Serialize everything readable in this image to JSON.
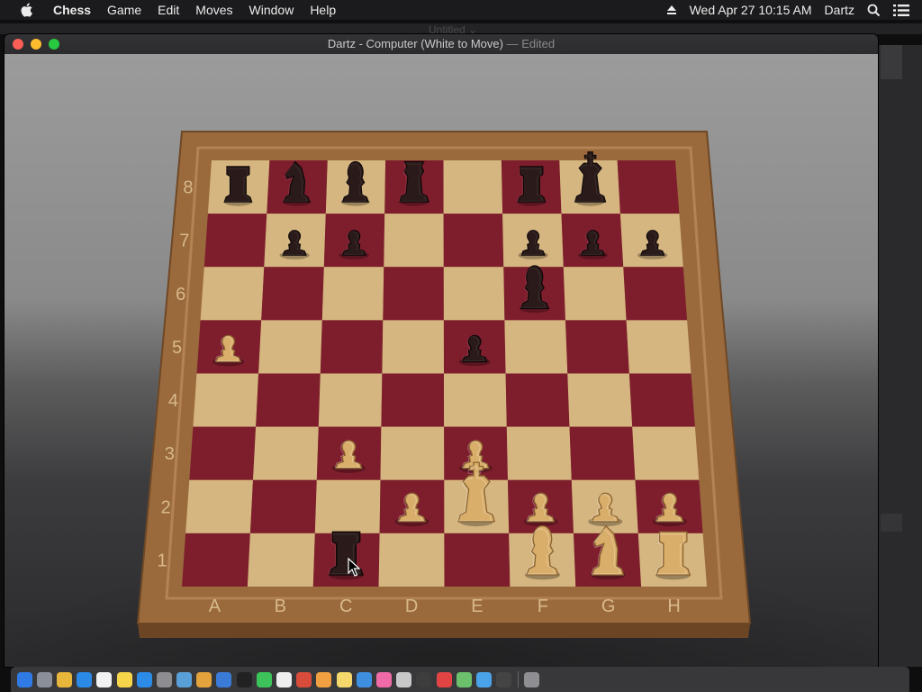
{
  "menubar": {
    "items": [
      {
        "label": "Chess",
        "name": "menu-chess"
      },
      {
        "label": "Game",
        "name": "menu-game"
      },
      {
        "label": "Edit",
        "name": "menu-edit"
      },
      {
        "label": "Moves",
        "name": "menu-moves"
      },
      {
        "label": "Window",
        "name": "menu-window"
      },
      {
        "label": "Help",
        "name": "menu-help"
      }
    ],
    "clock": "Wed Apr 27  10:15 AM",
    "user": "Dartz"
  },
  "background_window": {
    "title": "Untitled"
  },
  "window": {
    "title": "Dartz - Computer   (White to Move)",
    "status": "— Edited"
  },
  "board": {
    "files": [
      "A",
      "B",
      "C",
      "D",
      "E",
      "F",
      "G",
      "H"
    ],
    "ranks": [
      "8",
      "7",
      "6",
      "5",
      "4",
      "3",
      "2",
      "1"
    ],
    "pieces": [
      {
        "color": "black",
        "piece": "rook",
        "square": "a8"
      },
      {
        "color": "black",
        "piece": "knight",
        "square": "b8"
      },
      {
        "color": "black",
        "piece": "bishop",
        "square": "c8"
      },
      {
        "color": "black",
        "piece": "queen",
        "square": "d8"
      },
      {
        "color": "black",
        "piece": "rook",
        "square": "f8"
      },
      {
        "color": "black",
        "piece": "king",
        "square": "g8"
      },
      {
        "color": "black",
        "piece": "pawn",
        "square": "b7"
      },
      {
        "color": "black",
        "piece": "pawn",
        "square": "c7"
      },
      {
        "color": "black",
        "piece": "pawn",
        "square": "f7"
      },
      {
        "color": "black",
        "piece": "pawn",
        "square": "g7"
      },
      {
        "color": "black",
        "piece": "pawn",
        "square": "h7"
      },
      {
        "color": "black",
        "piece": "bishop",
        "square": "f6"
      },
      {
        "color": "black",
        "piece": "pawn",
        "square": "e5"
      },
      {
        "color": "white",
        "piece": "pawn",
        "square": "a5"
      },
      {
        "color": "white",
        "piece": "pawn",
        "square": "c3"
      },
      {
        "color": "white",
        "piece": "pawn",
        "square": "e3"
      },
      {
        "color": "white",
        "piece": "pawn",
        "square": "d2"
      },
      {
        "color": "white",
        "piece": "king",
        "square": "e2"
      },
      {
        "color": "white",
        "piece": "pawn",
        "square": "f2"
      },
      {
        "color": "white",
        "piece": "pawn",
        "square": "g2"
      },
      {
        "color": "white",
        "piece": "pawn",
        "square": "h2"
      },
      {
        "color": "black",
        "piece": "rook",
        "square": "c1"
      },
      {
        "color": "white",
        "piece": "bishop",
        "square": "f1"
      },
      {
        "color": "white",
        "piece": "knight",
        "square": "g1"
      },
      {
        "color": "white",
        "piece": "rook",
        "square": "h1"
      }
    ]
  },
  "colors": {
    "light_square": "#d6b680",
    "dark_square": "#7e1e2d",
    "frame": "#9b6a3c",
    "black_piece": "#2a1a1a",
    "white_piece": "#d9ae6a"
  },
  "dock": {
    "apps": [
      {
        "icon": "finder-icon",
        "color": "#2f7ae5"
      },
      {
        "icon": "launchpad-icon",
        "color": "#8a8f99"
      },
      {
        "icon": "chrome-icon",
        "color": "#e8b63a"
      },
      {
        "icon": "safari-icon",
        "color": "#2b8ae6"
      },
      {
        "icon": "calendar-icon",
        "color": "#f2f2f2"
      },
      {
        "icon": "notes-icon",
        "color": "#f7d54a"
      },
      {
        "icon": "app-store-icon",
        "color": "#2b8be6"
      },
      {
        "icon": "system-preferences-icon",
        "color": "#8d8d92"
      },
      {
        "icon": "preview-icon",
        "color": "#5aa0d8"
      },
      {
        "icon": "ibooks-icon",
        "color": "#e3a23b"
      },
      {
        "icon": "xcode-icon",
        "color": "#3b7bd8"
      },
      {
        "icon": "terminal-icon",
        "color": "#222222"
      },
      {
        "icon": "facetime-icon",
        "color": "#3cc45a"
      },
      {
        "icon": "texteditor-icon",
        "color": "#eeeeee"
      },
      {
        "icon": "photobooth-icon",
        "color": "#d94c3c"
      },
      {
        "icon": "photos-icon",
        "color": "#f0a040"
      },
      {
        "icon": "stickies-icon",
        "color": "#f5d86b"
      },
      {
        "icon": "keynote-icon",
        "color": "#3f8fe0"
      },
      {
        "icon": "itunes-icon",
        "color": "#f06aa8"
      },
      {
        "icon": "chess-icon",
        "color": "#c8c8c8"
      },
      {
        "icon": "activity-monitor-icon",
        "color": "#3d3d3d"
      },
      {
        "icon": "no-entry-icon",
        "color": "#e24444"
      },
      {
        "icon": "maps-icon",
        "color": "#6cc06c"
      },
      {
        "icon": "folder-icon",
        "color": "#4aa3e8"
      },
      {
        "icon": "console-icon",
        "color": "#444444"
      },
      {
        "icon": "trash-icon",
        "color": "#8e8e93"
      }
    ]
  }
}
